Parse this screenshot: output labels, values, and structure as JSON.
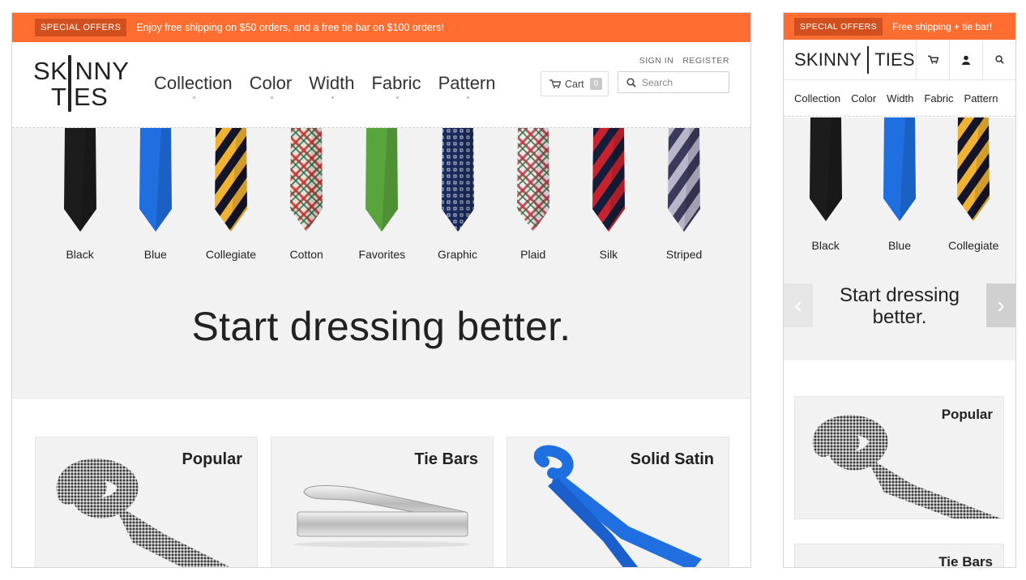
{
  "offers": {
    "badge": "SPECIAL OFFERS",
    "desktop_text": "Enjoy free shipping on $50 orders, and a free tie bar on $100 orders!",
    "mobile_text": "Free shipping + tie bar!"
  },
  "brand": {
    "line1": "SK NNY",
    "line2": "T ES",
    "mobile_left": "SKINNY",
    "mobile_right": "TIES"
  },
  "nav": [
    "Collection",
    "Color",
    "Width",
    "Fabric",
    "Pattern"
  ],
  "account": {
    "sign_in": "SIGN IN",
    "register": "REGISTER"
  },
  "cart": {
    "label": "Cart",
    "count": "0"
  },
  "search": {
    "placeholder": "Search"
  },
  "ties": [
    {
      "label": "Black",
      "colors": [
        "#1c1c1c"
      ],
      "pattern": "solid"
    },
    {
      "label": "Blue",
      "colors": [
        "#1f6fe0"
      ],
      "pattern": "solid"
    },
    {
      "label": "Collegiate",
      "colors": [
        "#f0b233",
        "#15152a"
      ],
      "pattern": "stripe"
    },
    {
      "label": "Cotton",
      "colors": [
        "#e8e0d4",
        "#c0342f",
        "#2d6a4e"
      ],
      "pattern": "plaid"
    },
    {
      "label": "Favorites",
      "colors": [
        "#5aa43d"
      ],
      "pattern": "solid"
    },
    {
      "label": "Graphic",
      "colors": [
        "#1a2a5c",
        "#e8edf5"
      ],
      "pattern": "dots"
    },
    {
      "label": "Plaid",
      "colors": [
        "#f1e8e8",
        "#b53a45",
        "#3f6d46"
      ],
      "pattern": "plaid"
    },
    {
      "label": "Silk",
      "colors": [
        "#c6232e",
        "#141d3b"
      ],
      "pattern": "stripe"
    },
    {
      "label": "Striped",
      "colors": [
        "#3c3a5a",
        "#b9b6cc"
      ],
      "pattern": "stripe"
    }
  ],
  "hero": {
    "title": "Start dressing better.",
    "mobile_title_1": "Start dressing",
    "mobile_title_2": "better."
  },
  "cards": [
    {
      "title": "Popular",
      "image": "houndstooth-rolled-tie"
    },
    {
      "title": "Tie Bars",
      "image": "silver-tie-bar"
    },
    {
      "title": "Solid Satin",
      "image": "blue-satin-tie"
    }
  ],
  "mobile_icons": [
    "cart-icon",
    "user-icon",
    "search-icon"
  ],
  "mobile_ties": [
    "Black",
    "Blue",
    "Collegiate"
  ],
  "mobile_cards": [
    "Popular",
    "Tie Bars"
  ],
  "colors": {
    "accent": "#ff6e30",
    "accent_dark": "#d2501f",
    "hero_bg": "#f2f2f2"
  }
}
